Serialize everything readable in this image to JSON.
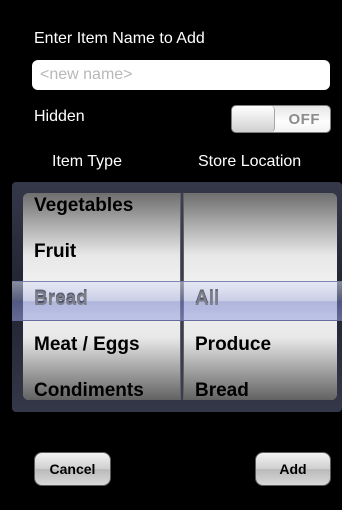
{
  "form": {
    "name_label": "Enter Item Name to Add",
    "name_value": "",
    "name_placeholder": "<new name>",
    "hidden_label": "Hidden",
    "hidden_toggle_state": "OFF"
  },
  "picker": {
    "headers": {
      "item_type": "Item Type",
      "store_location": "Store Location"
    },
    "item_types": [
      "Vegetables",
      "Fruit",
      "Bread",
      "Meat / Eggs",
      "Condiments"
    ],
    "store_locations": [
      "",
      "",
      "All",
      "Produce",
      "Bread"
    ],
    "selected_item_type": "Bread",
    "selected_store_location": "All"
  },
  "buttons": {
    "cancel": "Cancel",
    "add": "Add"
  }
}
